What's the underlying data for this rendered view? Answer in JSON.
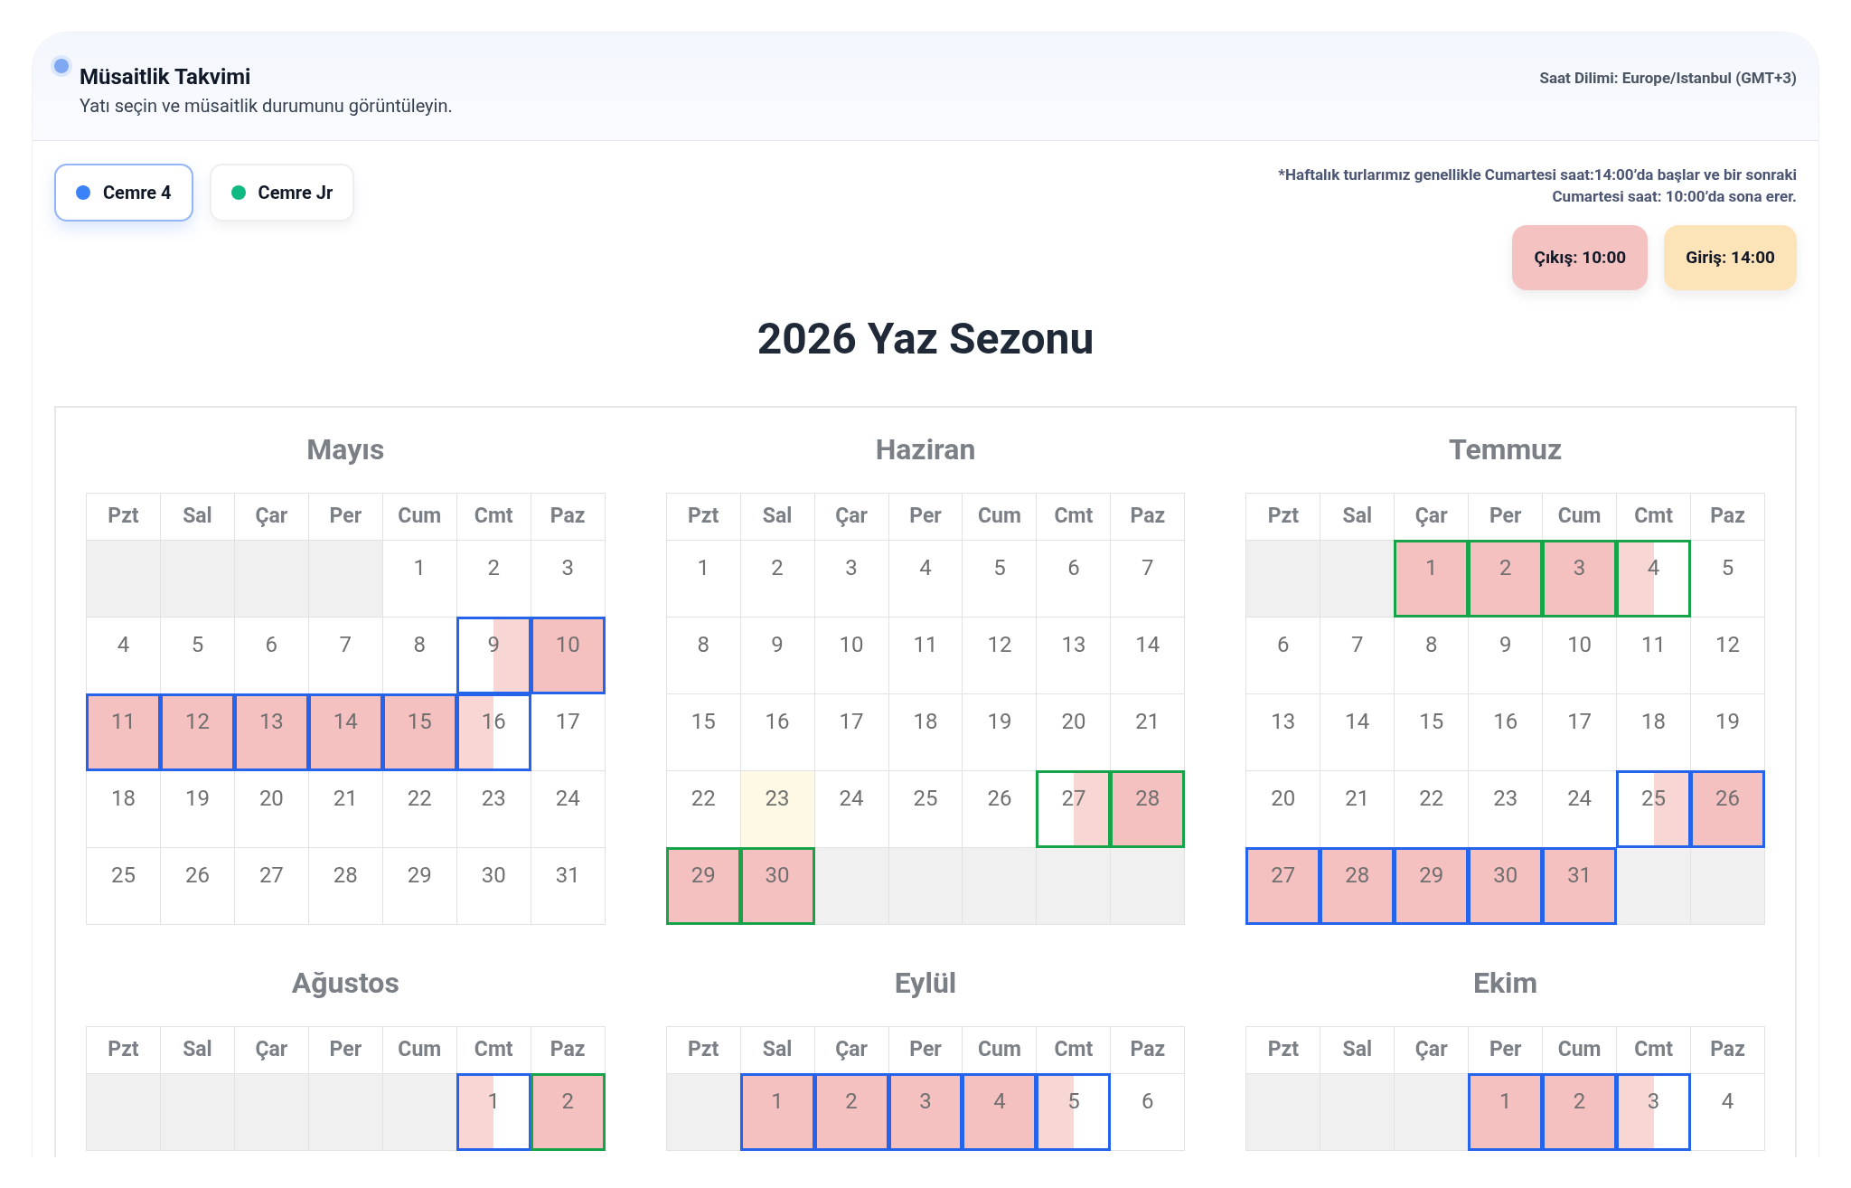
{
  "header": {
    "title": "Müsaitlik Takvimi",
    "subtitle": "Yatı seçin ve müsaitlik durumunu görüntüleyin.",
    "timezone": "Saat Dilimi: Europe/Istanbul (GMT+3)"
  },
  "yachts": [
    {
      "label": "Cemre 4",
      "color": "#3b82f6",
      "selected": true
    },
    {
      "label": "Cemre Jr",
      "color": "#10b981",
      "selected": false
    }
  ],
  "note": [
    "*Haftalık turlarımız genellikle Cumartesi saat:14:00’da başlar ve bir sonraki",
    "Cumartesi saat: 10:00’da sona erer."
  ],
  "legend": [
    {
      "kind": "checkout",
      "label": "Çıkış: 10:00"
    },
    {
      "kind": "checkin",
      "label": "Giriş: 14:00"
    }
  ],
  "season_title": "2026 Yaz Sezonu",
  "months": [
    {
      "name": "Mayıs",
      "weekdays": [
        "Pzt",
        "Sal",
        "Çar",
        "Per",
        "Cum",
        "Cmt",
        "Paz"
      ],
      "days": [
        {
          "kind": "blank"
        },
        {
          "kind": "blank"
        },
        {
          "kind": "blank"
        },
        {
          "kind": "blank"
        },
        {
          "kind": "free",
          "label": "1"
        },
        {
          "kind": "free",
          "label": "2"
        },
        {
          "kind": "free",
          "label": "3"
        },
        {
          "kind": "free",
          "label": "4"
        },
        {
          "kind": "free",
          "label": "5"
        },
        {
          "kind": "free",
          "label": "6"
        },
        {
          "kind": "free",
          "label": "7"
        },
        {
          "kind": "free",
          "label": "8"
        },
        {
          "kind": "checkin",
          "label": "9",
          "color": "#2563eb"
        },
        {
          "kind": "full",
          "label": "10",
          "color": "#2563eb"
        },
        {
          "kind": "full",
          "label": "11",
          "color": "#2563eb"
        },
        {
          "kind": "full",
          "label": "12",
          "color": "#2563eb"
        },
        {
          "kind": "full",
          "label": "13",
          "color": "#2563eb"
        },
        {
          "kind": "full",
          "label": "14",
          "color": "#2563eb"
        },
        {
          "kind": "full",
          "label": "15",
          "color": "#2563eb"
        },
        {
          "kind": "checkout",
          "label": "16",
          "color": "#2563eb"
        },
        {
          "kind": "free",
          "label": "17"
        },
        {
          "kind": "free",
          "label": "18"
        },
        {
          "kind": "free",
          "label": "19"
        },
        {
          "kind": "free",
          "label": "20"
        },
        {
          "kind": "free",
          "label": "21"
        },
        {
          "kind": "free",
          "label": "22"
        },
        {
          "kind": "free",
          "label": "23"
        },
        {
          "kind": "free",
          "label": "24"
        },
        {
          "kind": "free",
          "label": "25"
        },
        {
          "kind": "free",
          "label": "26"
        },
        {
          "kind": "free",
          "label": "27"
        },
        {
          "kind": "free",
          "label": "28"
        },
        {
          "kind": "free",
          "label": "29"
        },
        {
          "kind": "free",
          "label": "30"
        },
        {
          "kind": "free",
          "label": "31"
        }
      ]
    },
    {
      "name": "Haziran",
      "weekdays": [
        "Pzt",
        "Sal",
        "Çar",
        "Per",
        "Cum",
        "Cmt",
        "Paz"
      ],
      "days": [
        {
          "kind": "free",
          "label": "1"
        },
        {
          "kind": "free",
          "label": "2"
        },
        {
          "kind": "free",
          "label": "3"
        },
        {
          "kind": "free",
          "label": "4"
        },
        {
          "kind": "free",
          "label": "5"
        },
        {
          "kind": "free",
          "label": "6"
        },
        {
          "kind": "free",
          "label": "7"
        },
        {
          "kind": "free",
          "label": "8"
        },
        {
          "kind": "free",
          "label": "9"
        },
        {
          "kind": "free",
          "label": "10"
        },
        {
          "kind": "free",
          "label": "11"
        },
        {
          "kind": "free",
          "label": "12"
        },
        {
          "kind": "free",
          "label": "13"
        },
        {
          "kind": "free",
          "label": "14"
        },
        {
          "kind": "free",
          "label": "15"
        },
        {
          "kind": "free",
          "label": "16"
        },
        {
          "kind": "free",
          "label": "17"
        },
        {
          "kind": "free",
          "label": "18"
        },
        {
          "kind": "free",
          "label": "19"
        },
        {
          "kind": "free",
          "label": "20"
        },
        {
          "kind": "free",
          "label": "21"
        },
        {
          "kind": "free",
          "label": "22"
        },
        {
          "kind": "today",
          "label": "23"
        },
        {
          "kind": "free",
          "label": "24"
        },
        {
          "kind": "free",
          "label": "25"
        },
        {
          "kind": "free",
          "label": "26"
        },
        {
          "kind": "checkin",
          "label": "27",
          "color": "#16a34a"
        },
        {
          "kind": "full",
          "label": "28",
          "color": "#16a34a"
        },
        {
          "kind": "full",
          "label": "29",
          "color": "#16a34a"
        },
        {
          "kind": "full",
          "label": "30",
          "color": "#16a34a"
        },
        {
          "kind": "blank"
        },
        {
          "kind": "blank"
        },
        {
          "kind": "blank"
        },
        {
          "kind": "blank"
        },
        {
          "kind": "blank"
        }
      ]
    },
    {
      "name": "Temmuz",
      "weekdays": [
        "Pzt",
        "Sal",
        "Çar",
        "Per",
        "Cum",
        "Cmt",
        "Paz"
      ],
      "days": [
        {
          "kind": "blank"
        },
        {
          "kind": "blank"
        },
        {
          "kind": "full",
          "label": "1",
          "color": "#16a34a"
        },
        {
          "kind": "full",
          "label": "2",
          "color": "#16a34a"
        },
        {
          "kind": "full",
          "label": "3",
          "color": "#16a34a"
        },
        {
          "kind": "checkout",
          "label": "4",
          "color": "#16a34a"
        },
        {
          "kind": "free",
          "label": "5"
        },
        {
          "kind": "free",
          "label": "6"
        },
        {
          "kind": "free",
          "label": "7"
        },
        {
          "kind": "free",
          "label": "8"
        },
        {
          "kind": "free",
          "label": "9"
        },
        {
          "kind": "free",
          "label": "10"
        },
        {
          "kind": "free",
          "label": "11"
        },
        {
          "kind": "free",
          "label": "12"
        },
        {
          "kind": "free",
          "label": "13"
        },
        {
          "kind": "free",
          "label": "14"
        },
        {
          "kind": "free",
          "label": "15"
        },
        {
          "kind": "free",
          "label": "16"
        },
        {
          "kind": "free",
          "label": "17"
        },
        {
          "kind": "free",
          "label": "18"
        },
        {
          "kind": "free",
          "label": "19"
        },
        {
          "kind": "free",
          "label": "20"
        },
        {
          "kind": "free",
          "label": "21"
        },
        {
          "kind": "free",
          "label": "22"
        },
        {
          "kind": "free",
          "label": "23"
        },
        {
          "kind": "free",
          "label": "24"
        },
        {
          "kind": "checkin",
          "label": "25",
          "color": "#2563eb"
        },
        {
          "kind": "full",
          "label": "26",
          "color": "#2563eb"
        },
        {
          "kind": "full",
          "label": "27",
          "color": "#2563eb"
        },
        {
          "kind": "full",
          "label": "28",
          "color": "#2563eb"
        },
        {
          "kind": "full",
          "label": "29",
          "color": "#2563eb"
        },
        {
          "kind": "full",
          "label": "30",
          "color": "#2563eb"
        },
        {
          "kind": "full",
          "label": "31",
          "color": "#2563eb"
        },
        {
          "kind": "blank"
        },
        {
          "kind": "blank"
        }
      ]
    },
    {
      "name": "Ağustos",
      "weekdays": [
        "Pzt",
        "Sal",
        "Çar",
        "Per",
        "Cum",
        "Cmt",
        "Paz"
      ],
      "days": [
        {
          "kind": "blank"
        },
        {
          "kind": "blank"
        },
        {
          "kind": "blank"
        },
        {
          "kind": "blank"
        },
        {
          "kind": "blank"
        },
        {
          "kind": "checkout",
          "label": "1",
          "color": "#2563eb"
        },
        {
          "kind": "full",
          "label": "2",
          "color": "#16a34a"
        }
      ]
    },
    {
      "name": "Eylül",
      "weekdays": [
        "Pzt",
        "Sal",
        "Çar",
        "Per",
        "Cum",
        "Cmt",
        "Paz"
      ],
      "days": [
        {
          "kind": "blank"
        },
        {
          "kind": "full",
          "label": "1",
          "color": "#2563eb"
        },
        {
          "kind": "full",
          "label": "2",
          "color": "#2563eb"
        },
        {
          "kind": "full",
          "label": "3",
          "color": "#2563eb"
        },
        {
          "kind": "full",
          "label": "4",
          "color": "#2563eb"
        },
        {
          "kind": "checkout",
          "label": "5",
          "color": "#2563eb"
        },
        {
          "kind": "free",
          "label": "6"
        }
      ]
    },
    {
      "name": "Ekim",
      "weekdays": [
        "Pzt",
        "Sal",
        "Çar",
        "Per",
        "Cum",
        "Cmt",
        "Paz"
      ],
      "days": [
        {
          "kind": "blank"
        },
        {
          "kind": "blank"
        },
        {
          "kind": "blank"
        },
        {
          "kind": "full",
          "label": "1",
          "color": "#2563eb"
        },
        {
          "kind": "full",
          "label": "2",
          "color": "#2563eb"
        },
        {
          "kind": "checkout",
          "label": "3",
          "color": "#2563eb"
        },
        {
          "kind": "free",
          "label": "4"
        }
      ]
    }
  ]
}
